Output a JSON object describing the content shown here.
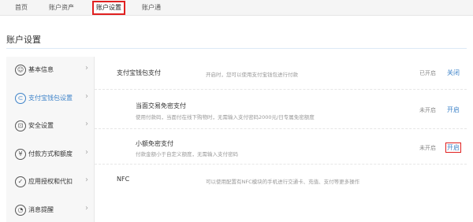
{
  "topnav": {
    "tabs": [
      {
        "label": "首页"
      },
      {
        "label": "账户资产"
      },
      {
        "label": "账户设置"
      },
      {
        "label": "账户通"
      }
    ]
  },
  "page": {
    "title": "账户设置"
  },
  "sidebar": {
    "items": [
      {
        "label": "基本信息",
        "icon": "user-icon",
        "glyph": "☺"
      },
      {
        "label": "支付宝钱包设置",
        "icon": "wallet-icon",
        "glyph": "⊂"
      },
      {
        "label": "安全设置",
        "icon": "lock-icon",
        "glyph": "⊡"
      },
      {
        "label": "付款方式和额度",
        "icon": "yen-icon",
        "glyph": "¥"
      },
      {
        "label": "应用授权和代扣",
        "icon": "check-icon",
        "glyph": "✓"
      },
      {
        "label": "消息提醒",
        "icon": "bell-icon",
        "glyph": "◔"
      }
    ],
    "chevron": "›"
  },
  "rows": [
    {
      "name": "支付宝钱包支付",
      "desc": "开启时，您可以使用支付宝钱包进行付款",
      "status": "已开启",
      "action": "关闭"
    },
    {
      "name": "当面交易免密支付",
      "desc": "使用付款码，当面付在线下购物时，无需输入支付密码2000元/日专属免密额度",
      "status": "未开启",
      "action": "开启"
    },
    {
      "name": "小额免密支付",
      "desc": "付款金额小于自定义额度，无需输入支付密码",
      "status": "未开启",
      "action": "开启"
    },
    {
      "name": "NFC",
      "desc": "可以使用配置有NFC模块的手机进行交通卡、充值、支付等更多操作",
      "status": "",
      "action": ""
    }
  ],
  "colors": {
    "accent": "#3e83c9",
    "highlight_border": "#e02020"
  }
}
